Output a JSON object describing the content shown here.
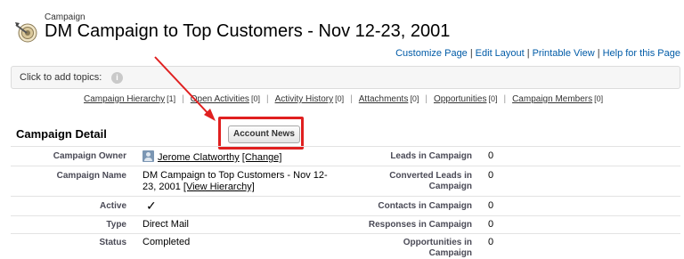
{
  "header": {
    "object_type": "Campaign",
    "title": "DM Campaign to Top Customers - Nov 12-23, 2001",
    "links": [
      "Customize Page",
      "Edit Layout",
      "Printable View",
      "Help for this Page"
    ],
    "separator": "|"
  },
  "topics": {
    "label": "Click to add topics:",
    "info_glyph": "i"
  },
  "related_links": [
    {
      "label": "Campaign Hierarchy",
      "count": "[1]"
    },
    {
      "label": "Open Activities",
      "count": "[0]"
    },
    {
      "label": "Activity History",
      "count": "[0]"
    },
    {
      "label": "Attachments",
      "count": "[0]"
    },
    {
      "label": "Opportunities",
      "count": "[0]"
    },
    {
      "label": "Campaign Members",
      "count": "[0]"
    }
  ],
  "detail": {
    "section_title": "Campaign Detail",
    "button_label": "Account News",
    "left": [
      {
        "label": "Campaign Owner",
        "value": "Jerome Clatworthy",
        "link": "[Change]"
      },
      {
        "label": "Campaign Name",
        "value": "DM Campaign to Top Customers - Nov 12-",
        "value2": "23, 2001",
        "link": "[View Hierarchy]"
      },
      {
        "label": "Active",
        "value": "✓"
      },
      {
        "label": "Type",
        "value": "Direct Mail"
      },
      {
        "label": "Status",
        "value": "Completed"
      }
    ],
    "right": [
      {
        "label": "Leads in Campaign",
        "value": "0"
      },
      {
        "label": "Converted Leads in",
        "label2": "Campaign",
        "value": "0"
      },
      {
        "label": "Contacts in Campaign",
        "value": "0"
      },
      {
        "label": "Responses in Campaign",
        "value": "0"
      },
      {
        "label": "Opportunities in",
        "label2": "Campaign",
        "value": "0"
      }
    ]
  },
  "colors": {
    "link": "#015ba7",
    "highlight": "#e02020",
    "bar_bg": "#f6f6f6"
  }
}
